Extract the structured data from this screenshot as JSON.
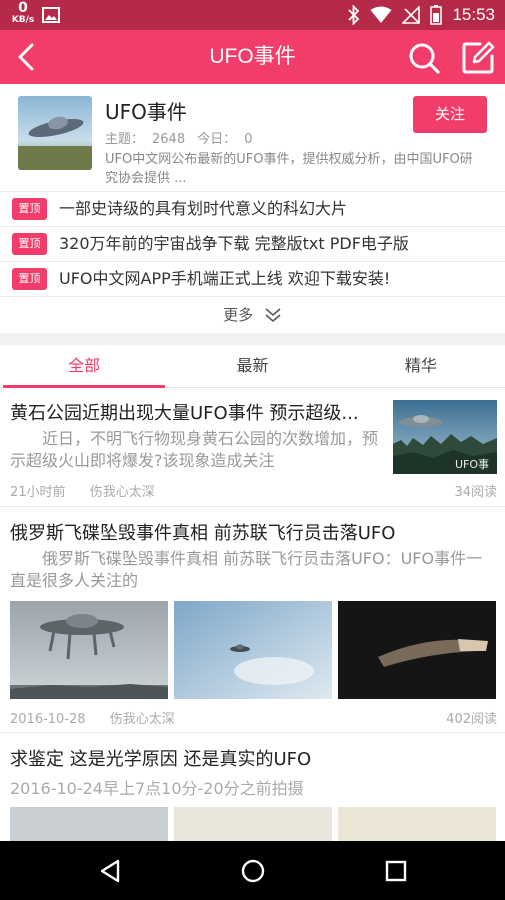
{
  "status_bar": {
    "net_speed_value": "0",
    "net_speed_unit": "KB/s",
    "time": "15:53"
  },
  "app_bar": {
    "title": "UFO事件"
  },
  "forum": {
    "name": "UFO事件",
    "topics_label": "主题：",
    "topics_value": "2648",
    "today_label": "今日：",
    "today_value": "0",
    "description": "UFO中文网公布最新的UFO事件，提供权威分析，由中国UFO研究协会提供 ...",
    "follow_label": "关注"
  },
  "pinned": {
    "tag_label": "置顶",
    "items": [
      {
        "text": "一部史诗级的具有划时代意义的科幻大片"
      },
      {
        "text": "320万年前的宇宙战争下载 完整版txt PDF电子版"
      },
      {
        "text": "UFO中文网APP手机端正式上线  欢迎下载安装!"
      }
    ],
    "more_label": "更多"
  },
  "tabs": [
    {
      "label": "全部",
      "active": true
    },
    {
      "label": "最新",
      "active": false
    },
    {
      "label": "精华",
      "active": false
    }
  ],
  "posts": [
    {
      "title": "黄石公园近期出现大量UFO事件 预示超级...",
      "summary": "近日，不明飞行物现身黄石公园的次数增加，预示超级火山即将爆发?该现象造成关注",
      "time": "21小时前",
      "author": "伤我心太深",
      "reads": "34阅读",
      "image_watermark": "UFO事"
    },
    {
      "title": "俄罗斯飞碟坠毁事件真相 前苏联飞行员击落UFO",
      "summary": "俄罗斯飞碟坠毁事件真相 前苏联飞行员击落UFO：UFO事件一直是很多人关注的",
      "time": "2016-10-28",
      "author": "伤我心太深",
      "reads": "402阅读"
    },
    {
      "title": "求鉴定 这是光学原因 还是真实的UFO",
      "summary": "2016-10-24早上7点10分-20分之前拍摄"
    }
  ],
  "colors": {
    "accent": "#f23d6a",
    "status_bar": "#b52a49",
    "meta_text": "#aaaaaa"
  },
  "icons": {
    "back": "back-arrow-icon",
    "search": "search-icon",
    "edit": "edit-icon",
    "more": "double-chevron-down-icon"
  }
}
